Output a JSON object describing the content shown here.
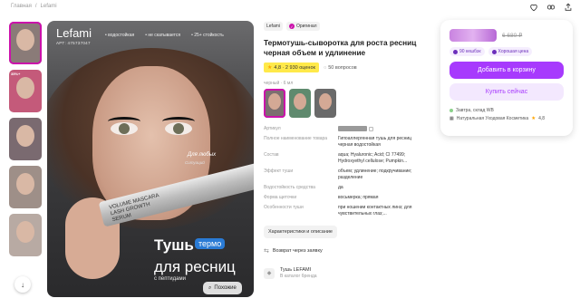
{
  "breadcrumb": [
    "Главная",
    "/",
    "Lefami"
  ],
  "header_icons": [
    "heart-icon",
    "compare-icon",
    "share-icon"
  ],
  "thumbnails": [
    {
      "label": "",
      "bg": "#8a7b78"
    },
    {
      "label": "35%+",
      "bg": "#c45a7a"
    },
    {
      "label": "",
      "bg": "#7a6a70"
    },
    {
      "label": "",
      "bg": "#9e8f88"
    },
    {
      "label": "",
      "bg": "#b8aaa3"
    },
    {
      "label": "",
      "bg": "#a09c9a"
    }
  ],
  "main_image": {
    "brand": "Lefami",
    "article": "АРТ: 475737047",
    "tags": [
      "• водостойкая",
      "• не скатывается",
      "• 25+ стойкость"
    ],
    "tagline": "Для любых",
    "tagline_sub": "Ситуаций",
    "mascara_text": "VOLUME MASCARA LASH GROWTH SERUM",
    "promo_line1": "Тушь",
    "promo_badge": "термо",
    "promo_line2": "для ресниц",
    "promo_line3": "с пептидами",
    "similar_button": "Похожие"
  },
  "product": {
    "brand_chip": "Lefami",
    "original_chip": "Оригинал",
    "title": "Термотушь-сыворотка для роста ресниц черная объем и удлинение",
    "rating": "4,8 · 2 930 оценок",
    "questions": "50 вопросов",
    "color_label": "черный · 6 мл",
    "swatches": [
      {
        "bg": "#7c6f70"
      },
      {
        "bg": "#5f8a6e"
      },
      {
        "bg": "#6a6a6a"
      }
    ],
    "specs": [
      {
        "k": "Артикул",
        "v": ""
      },
      {
        "k": "Полное наименование товара",
        "v": "Гипоаллергенная тушь для ресниц черная водостойкая"
      },
      {
        "k": "Состав",
        "v": "aqua; Hyaluronic; Acid; CI 77499; Hydroxyethyl cellulose; Pumpkin..."
      },
      {
        "k": "Эффект туши",
        "v": "объем; удлинение; подкручивание; разделение"
      },
      {
        "k": "Водостойкость средства",
        "v": "да"
      },
      {
        "k": "Форма щеточки",
        "v": "восьмерка; прямая"
      },
      {
        "k": "Особенности туши",
        "v": "при ношении контактных линз; для чувствительных глаз;..."
      }
    ],
    "chars_button": "Характеристики и описание",
    "return_text": "Возврат через заявку",
    "brand_card_name": "Тушь LEFAMI",
    "brand_card_sub": "В каталог бренда"
  },
  "buy": {
    "old_price": "6 680 ₽",
    "badge1": "90 кешбэк",
    "badge2": "Хорошая цена",
    "add_to_cart": "Добавить в корзину",
    "buy_now": "Купить сейчас",
    "delivery": "Завтра, склад WB",
    "seller": "Натуральная Уходовая Косметика",
    "seller_rating": "4,8"
  },
  "colors": {
    "accent": "#cb11ab",
    "button": "#a73afd",
    "highlight": "#ffe94a"
  }
}
